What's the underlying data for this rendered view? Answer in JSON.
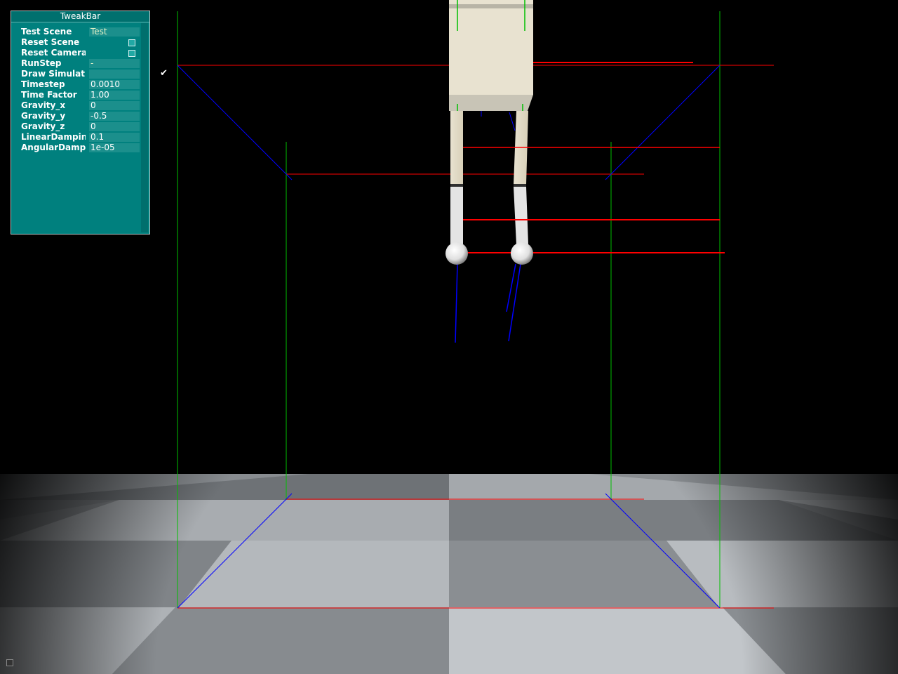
{
  "tweakbar": {
    "title": "TweakBar",
    "rows": [
      {
        "label": "Test Scene",
        "type": "text",
        "value": "Test"
      },
      {
        "label": "Reset Scene",
        "type": "button"
      },
      {
        "label": "Reset Camera",
        "type": "button"
      },
      {
        "label": "RunStep",
        "type": "text",
        "value": "-"
      },
      {
        "label": "Draw Simulati..",
        "type": "check",
        "checked": true
      },
      {
        "label": "Timestep",
        "type": "value",
        "value": "0.0010"
      },
      {
        "label": "Time Factor",
        "type": "value",
        "value": "1.00"
      },
      {
        "label": "Gravity_x",
        "type": "value",
        "value": "0"
      },
      {
        "label": "Gravity_y",
        "type": "value",
        "value": "-0.5"
      },
      {
        "label": "Gravity_z",
        "type": "value",
        "value": "0"
      },
      {
        "label": "LinearDamping",
        "type": "value",
        "value": "0.1"
      },
      {
        "label": "AngularDampi..",
        "type": "value",
        "value": "1e-05"
      }
    ]
  },
  "colors": {
    "panel": "#00807e",
    "axis_x": "#ff0000",
    "axis_y": "#00c000",
    "axis_z": "#0000ff",
    "floor_light": "#b8bcc0",
    "floor_dark": "#7c8084",
    "body": "#e8e2d0"
  },
  "icons": {
    "checkmark": "checkmark-icon",
    "button": "square-button-icon"
  }
}
